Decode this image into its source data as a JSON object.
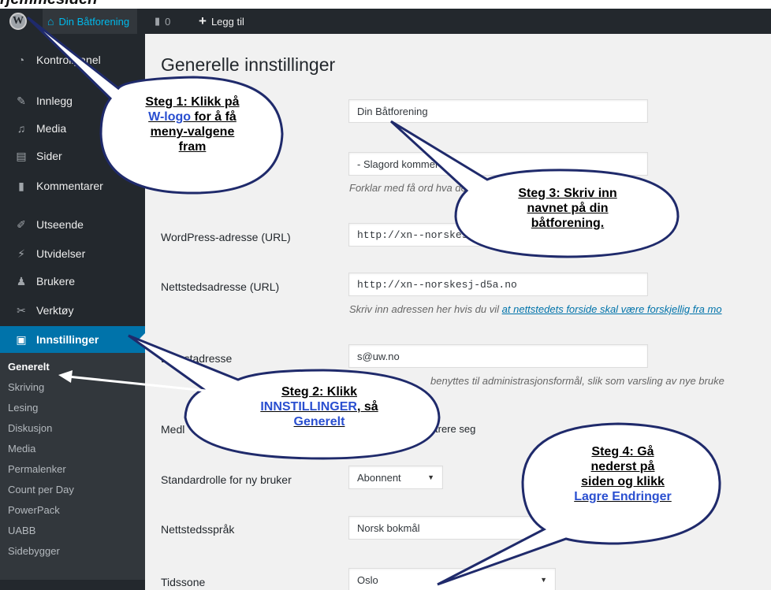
{
  "page_heading": "rjemmesiden",
  "adminbar": {
    "site_name": "Din Båtforening",
    "comments_count": "0",
    "add_new": "Legg til"
  },
  "sidebar": {
    "items": [
      {
        "label": "Kontrollpanel",
        "icon": "dashboard-icon"
      },
      {
        "label": "Innlegg",
        "icon": "pin-icon"
      },
      {
        "label": "Media",
        "icon": "media-icon"
      },
      {
        "label": "Sider",
        "icon": "page-icon"
      },
      {
        "label": "Kommentarer",
        "icon": "comment-icon"
      },
      {
        "label": "Utseende",
        "icon": "brush-icon"
      },
      {
        "label": "Utvidelser",
        "icon": "plugin-icon"
      },
      {
        "label": "Brukere",
        "icon": "users-icon"
      },
      {
        "label": "Verktøy",
        "icon": "wrench-icon"
      },
      {
        "label": "Innstillinger",
        "icon": "settings-icon"
      }
    ],
    "submenu": [
      "Generelt",
      "Skriving",
      "Lesing",
      "Diskusjon",
      "Media",
      "Permalenker",
      "Count per Day",
      "PowerPack",
      "UABB",
      "Sidebygger"
    ]
  },
  "main": {
    "title": "Generelle innstillinger",
    "site_title_value": "Din Båtforening",
    "tagline_value": "- Slagord kommer her",
    "tagline_desc": "Forklar med få ord hva dette nettstedet handler om.",
    "wp_address_label": "WordPress-adresse (URL)",
    "wp_address_value": "http://xn--norskesj-d5a.no",
    "site_address_label": "Nettstedsadresse (URL)",
    "site_address_value": "http://xn--norskesj-d5a.no",
    "site_address_desc_prefix": "Skriv inn adressen her hvis du vil ",
    "site_address_desc_link": "at nettstedets forside skal være forskjellig fra mo",
    "email_label": "E-postadresse",
    "email_value": "s@uw.no",
    "email_desc": "benyttes til administrasjonsformål, slik som varsling av nye bruke",
    "membership_label": "Medl",
    "membership_desc": "trere seg",
    "role_label": "Standardrolle for ny bruker",
    "role_value": "Abonnent",
    "language_label": "Nettstedsspråk",
    "language_value": "Norsk bokmål",
    "timezone_label": "Tidssone",
    "timezone_value": "Oslo"
  },
  "callouts": {
    "step1_a": "Steg 1: Klikk på",
    "step1_link": "W-logo",
    "step1_b": " for å få",
    "step1_c": "meny-valgene",
    "step1_d": "fram",
    "step2_a": "Steg 2: Klikk",
    "step2_link": "INNSTILLINGER",
    "step2_b": ", så",
    "step2_link2": "Generelt",
    "step3_a": "Steg 3: Skriv inn",
    "step3_b": "navnet på din",
    "step3_c": "båtforening.",
    "step4_a": "Steg 4: Gå",
    "step4_b": "nederst på",
    "step4_c": "siden og klikk",
    "step4_link": "Lagre Endringer"
  },
  "colors": {
    "adminbar": "#23282d",
    "active_menu": "#0073aa",
    "callout_border": "#1f2a6b",
    "link_blue": "#2a4fd0"
  }
}
